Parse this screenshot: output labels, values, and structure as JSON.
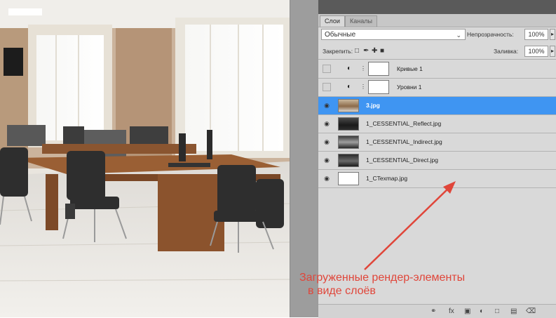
{
  "panel": {
    "tabs": [
      {
        "label": "Слои",
        "active": true
      },
      {
        "label": "Каналы",
        "active": false
      }
    ],
    "blend_mode": "Обычные",
    "opacity_label": "Непрозрачность:",
    "opacity_value": "100%",
    "lock_label": "Закрепить:",
    "fill_label": "Заливка:",
    "fill_value": "100%",
    "layers": [
      {
        "name": "Кривые 1",
        "type": "adjustment",
        "visible": false,
        "selected": false
      },
      {
        "name": "Уровни 1",
        "type": "adjustment",
        "visible": false,
        "selected": false
      },
      {
        "name": "3.jpg",
        "type": "image",
        "visible": true,
        "selected": true
      },
      {
        "name": "1_CESSENTIAL_Reflect.jpg",
        "type": "image",
        "visible": true,
        "selected": false
      },
      {
        "name": "1_CESSENTIAL_Indirect.jpg",
        "type": "image",
        "visible": true,
        "selected": false
      },
      {
        "name": "1_CESSENTIAL_Direct.jpg",
        "type": "image",
        "visible": true,
        "selected": false
      },
      {
        "name": "1_CTexmap.jpg",
        "type": "image",
        "visible": true,
        "selected": false
      }
    ]
  },
  "annotation": {
    "line1": "Загруженные рендер-элементы",
    "line2": "в виде слоёв",
    "color": "#e0463a"
  },
  "colors": {
    "selection": "#3f95f2",
    "panel_bg": "#d9d9d9"
  }
}
